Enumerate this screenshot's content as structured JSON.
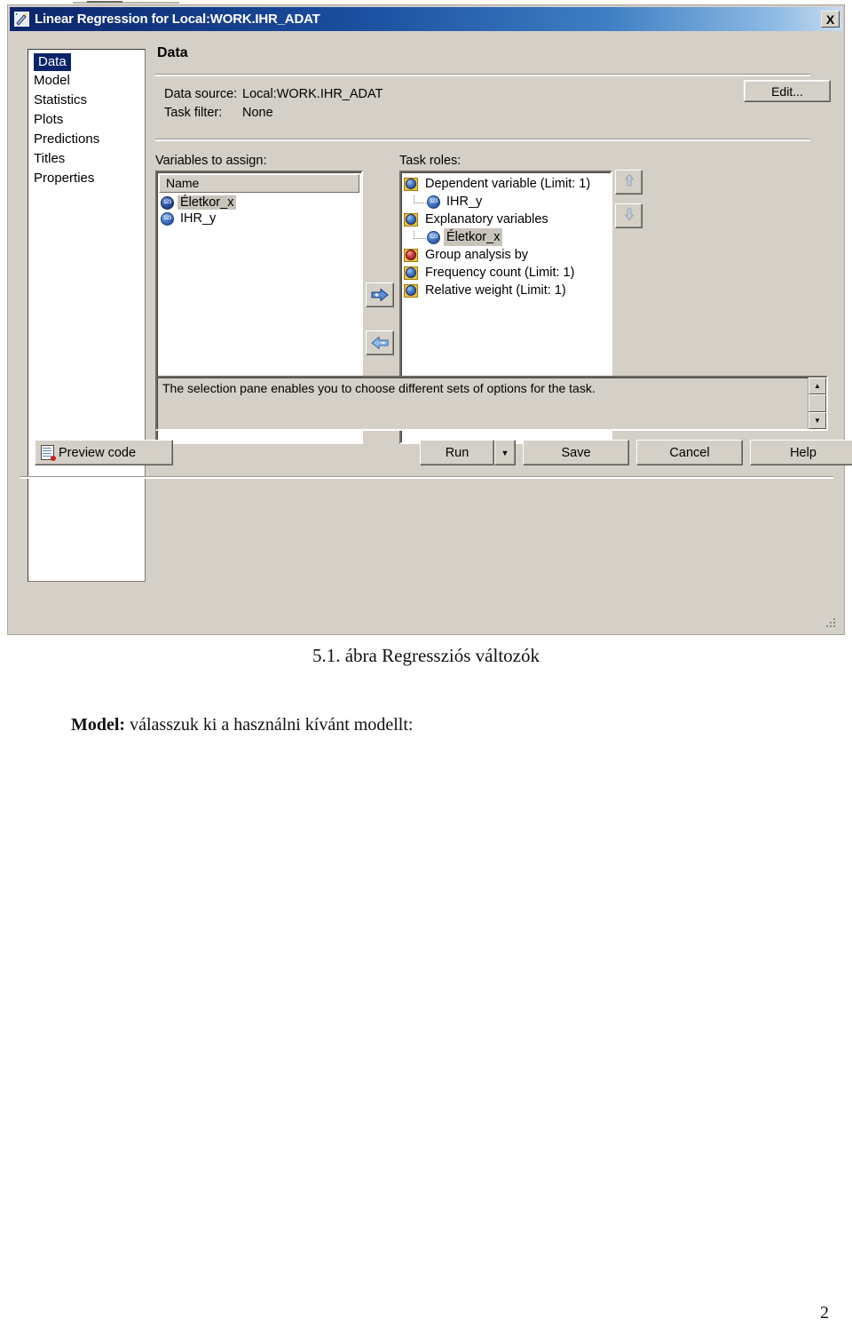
{
  "window": {
    "title": "Linear Regression for Local:WORK.IHR_ADAT",
    "title_icon": "wand-icon",
    "close_label": "X"
  },
  "selection_pane": {
    "items": [
      {
        "label": "Data",
        "selected": true
      },
      {
        "label": "Model",
        "selected": false
      },
      {
        "label": "Statistics",
        "selected": false
      },
      {
        "label": "Plots",
        "selected": false
      },
      {
        "label": "Predictions",
        "selected": false
      },
      {
        "label": "Titles",
        "selected": false
      },
      {
        "label": "Properties",
        "selected": false
      }
    ]
  },
  "content": {
    "heading": "Data",
    "data_source_label": "Data source:",
    "data_source_value": "Local:WORK.IHR_ADAT",
    "task_filter_label": "Task filter:",
    "task_filter_value": "None",
    "edit_label": "Edit...",
    "variables_label": "Variables to assign:",
    "variables_header": "Name",
    "variables": [
      {
        "name": "Életkor_x",
        "icon": "numeric-variable-icon",
        "selected": true
      },
      {
        "name": "IHR_y",
        "icon": "numeric-variable-icon",
        "selected": false
      }
    ],
    "task_roles_label": "Task roles:",
    "task_roles": [
      {
        "label": "Dependent variable  (Limit: 1)",
        "icon": "role-icon",
        "level": 0,
        "highlight": false
      },
      {
        "label": "IHR_y",
        "icon": "numeric-variable-icon",
        "level": 1,
        "highlight": false
      },
      {
        "label": "Explanatory variables",
        "icon": "role-icon",
        "level": 0,
        "highlight": false
      },
      {
        "label": "Életkor_x",
        "icon": "numeric-variable-icon",
        "level": 1,
        "highlight": true
      },
      {
        "label": "Group analysis by",
        "icon": "group-role-icon",
        "level": 0,
        "highlight": false
      },
      {
        "label": "Frequency count  (Limit: 1)",
        "icon": "role-icon",
        "level": 0,
        "highlight": false
      },
      {
        "label": "Relative weight  (Limit: 1)",
        "icon": "role-icon",
        "level": 0,
        "highlight": false
      }
    ],
    "assign_button": "assign-right-arrow",
    "unassign_button": "unassign-left-arrow",
    "move_up_button": "move-up-arrow",
    "move_down_button": "move-down-arrow",
    "help_text": "The selection pane enables you to choose different sets of options for the task.",
    "scroll_up": "▲",
    "scroll_down": "▼"
  },
  "buttons": {
    "preview_code": "Preview code",
    "run": "Run",
    "run_dropdown": "▼",
    "save": "Save",
    "cancel": "Cancel",
    "help": "Help"
  },
  "document": {
    "caption": "5.1. ábra Regressziós változók",
    "paragraph_bold": "Model:",
    "paragraph_rest": " válasszuk ki a használni kívánt modellt:",
    "page_number": "2"
  },
  "colors": {
    "titlebar_start": "#0b246a",
    "titlebar_end": "#c8dcf0",
    "dialog_face": "#d4d0c8",
    "selection_highlight": "#0a246a",
    "list_highlight": "#c8c4bc",
    "role_icon": "#f0c040",
    "numeric_icon": "#3f72c0"
  }
}
